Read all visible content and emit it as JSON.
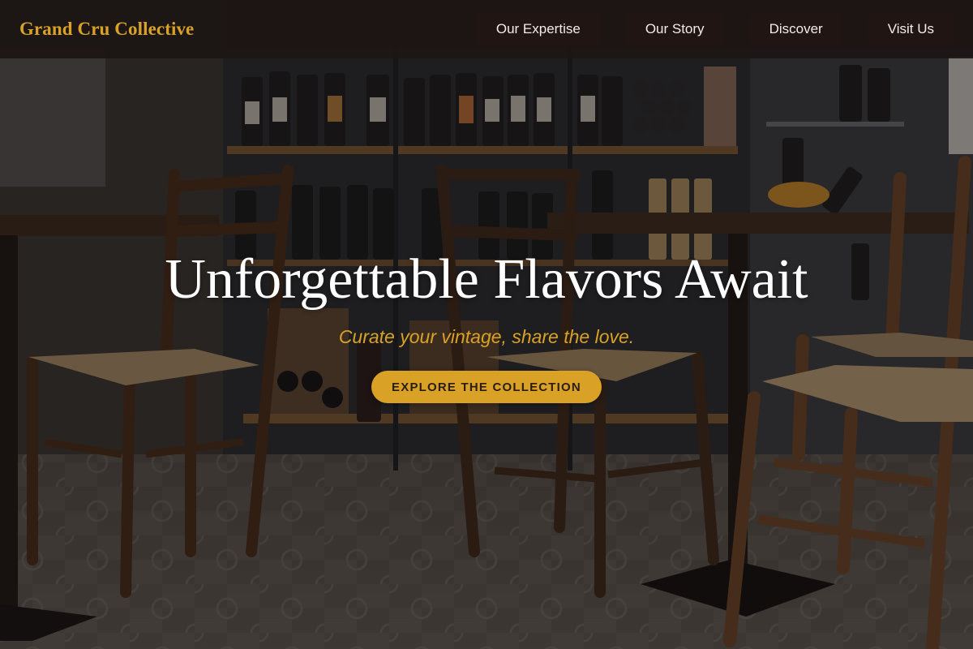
{
  "header": {
    "brand": "Grand Cru Collective",
    "nav": [
      {
        "label": "Our Expertise"
      },
      {
        "label": "Our Story"
      },
      {
        "label": "Discover"
      },
      {
        "label": "Visit Us"
      }
    ]
  },
  "hero": {
    "title": "Unforgettable Flavors Await",
    "subtitle": "Curate your vintage, share the love.",
    "cta_label": "EXPLORE THE COLLECTION"
  },
  "colors": {
    "accent": "#d9a227",
    "header_bg": "#1c1614",
    "nav_button_bg": "#201513",
    "hero_title": "#ffffff"
  }
}
